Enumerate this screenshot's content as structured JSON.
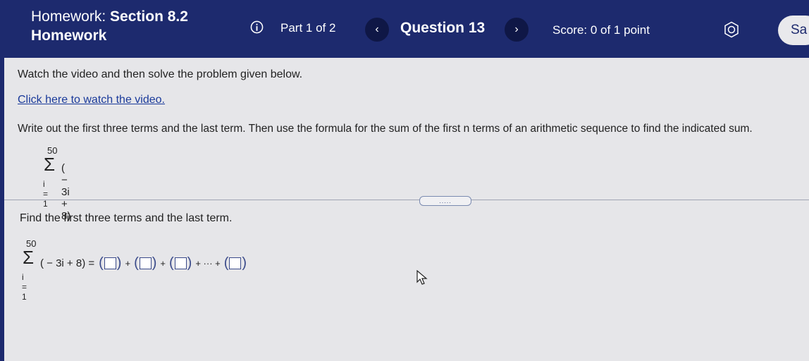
{
  "header": {
    "hw_line1_prefix": "Homework:",
    "hw_line1_section": "Section 8.2",
    "hw_line2": "Homework",
    "part": "Part 1 of 2",
    "prev_glyph": "‹",
    "question": "Question 13",
    "next_glyph": "›",
    "score": "Score: 0 of 1 point",
    "save_label": "Sa"
  },
  "content": {
    "instruction": "Watch the video and then solve the problem given below.",
    "video_link": "Click here to watch the video.",
    "problem": "Write out the first three terms and the last term. Then use the formula for the sum of the first n terms of an arithmetic sequence to find the indicated sum.",
    "sum_upper": "50",
    "sum_symbol": "Σ",
    "sum_lower": "i = 1",
    "sum_expr": "( − 3i + 8)",
    "divider_dots": ".....",
    "subtask": "Find the first three terms and the last term.",
    "answer_upper": "50",
    "answer_lower": "i = 1",
    "answer_expr": "( − 3i + 8) =",
    "plus": "+",
    "ellipsis_plus": "+ ··· +"
  }
}
